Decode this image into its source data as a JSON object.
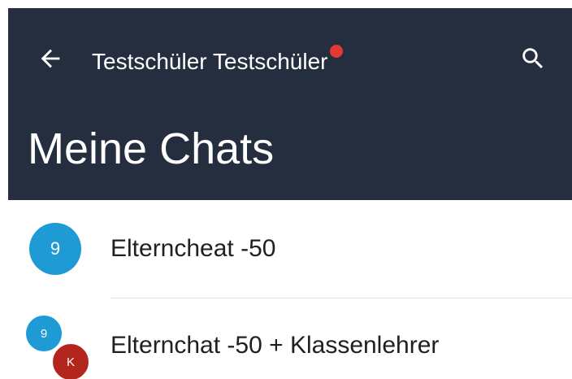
{
  "colors": {
    "header_bg": "#252e3e",
    "notification_dot": "#e53935",
    "avatar_blue": "#1e9bd4",
    "avatar_red": "#b3261e"
  },
  "toolbar": {
    "back_icon": "arrow-left-icon",
    "title": "Testschüler Testschüler",
    "search_icon": "search-icon"
  },
  "page": {
    "title": "Meine Chats"
  },
  "chats": [
    {
      "name": "Elterncheat -50",
      "avatar_label": "9"
    },
    {
      "name": "Elternchat -50 + Klassenlehrer",
      "avatar_labels": [
        "9",
        "K"
      ]
    }
  ]
}
